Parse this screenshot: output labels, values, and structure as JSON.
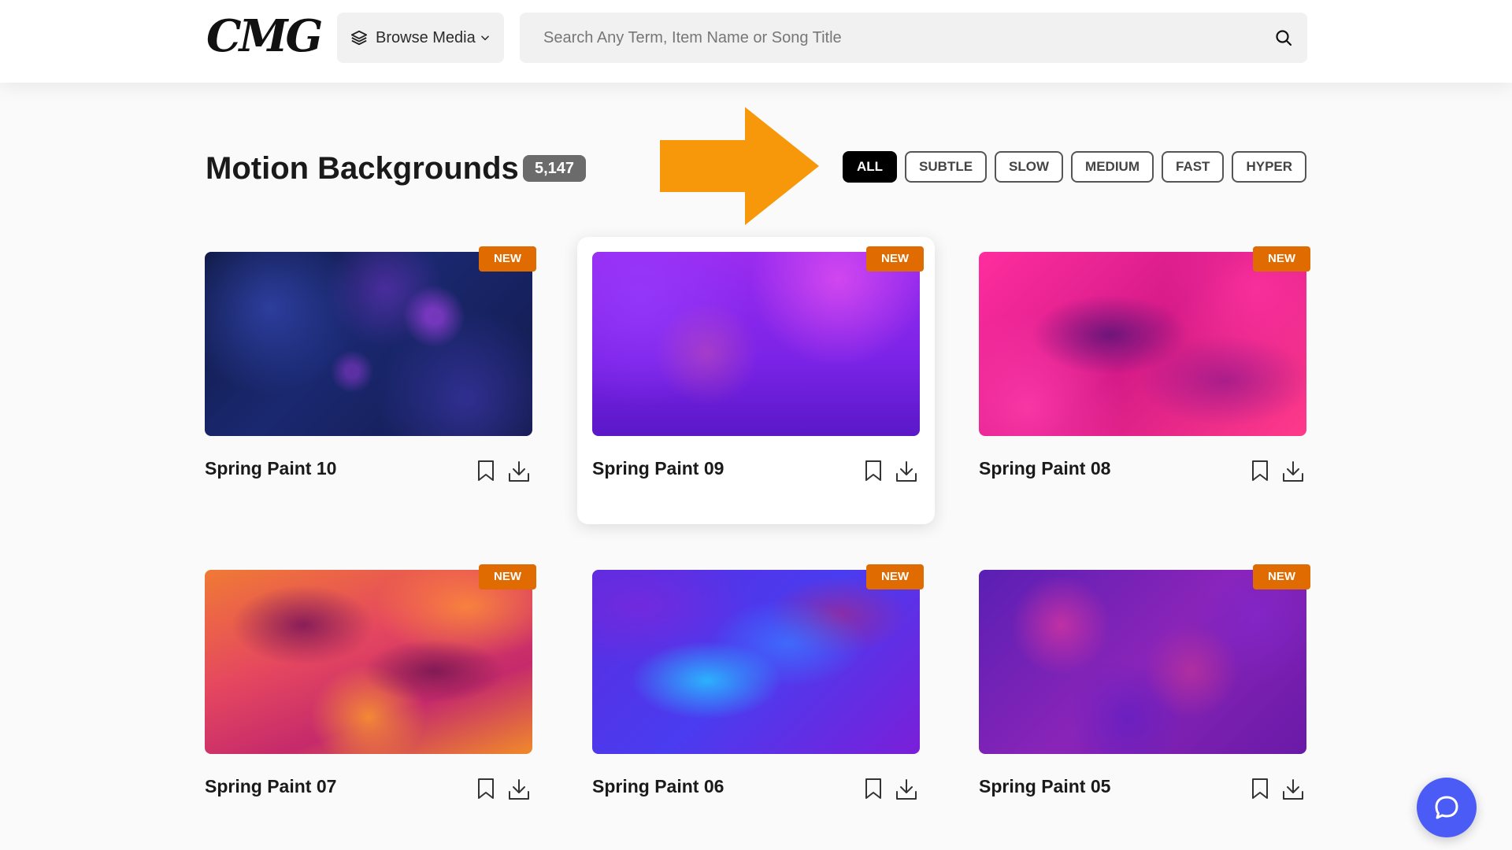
{
  "header": {
    "logo": "CMG",
    "browse_label": "Browse Media",
    "search_placeholder": "Search Any Term, Item Name or Song Title",
    "search_value": ""
  },
  "page": {
    "title": "Motion Backgrounds",
    "count": "5,147"
  },
  "filters": [
    {
      "label": "ALL",
      "active": true
    },
    {
      "label": "SUBTLE",
      "active": false
    },
    {
      "label": "SLOW",
      "active": false
    },
    {
      "label": "MEDIUM",
      "active": false
    },
    {
      "label": "FAST",
      "active": false
    },
    {
      "label": "HYPER",
      "active": false
    }
  ],
  "items": [
    {
      "title": "Spring Paint 10",
      "badge": "NEW"
    },
    {
      "title": "Spring Paint 09",
      "badge": "NEW"
    },
    {
      "title": "Spring Paint 08",
      "badge": "NEW"
    },
    {
      "title": "Spring Paint 07",
      "badge": "NEW"
    },
    {
      "title": "Spring Paint 06",
      "badge": "NEW"
    },
    {
      "title": "Spring Paint 05",
      "badge": "NEW"
    }
  ],
  "colors": {
    "accent_arrow": "#f7980a",
    "new_badge": "#e06b00",
    "help_bubble": "#4a5cf5",
    "active_filter": "#000000"
  },
  "icons": {
    "browse": "layers-icon",
    "search": "search-icon",
    "bookmark": "bookmark-icon",
    "download": "download-icon",
    "help": "chat-bubble-icon"
  }
}
